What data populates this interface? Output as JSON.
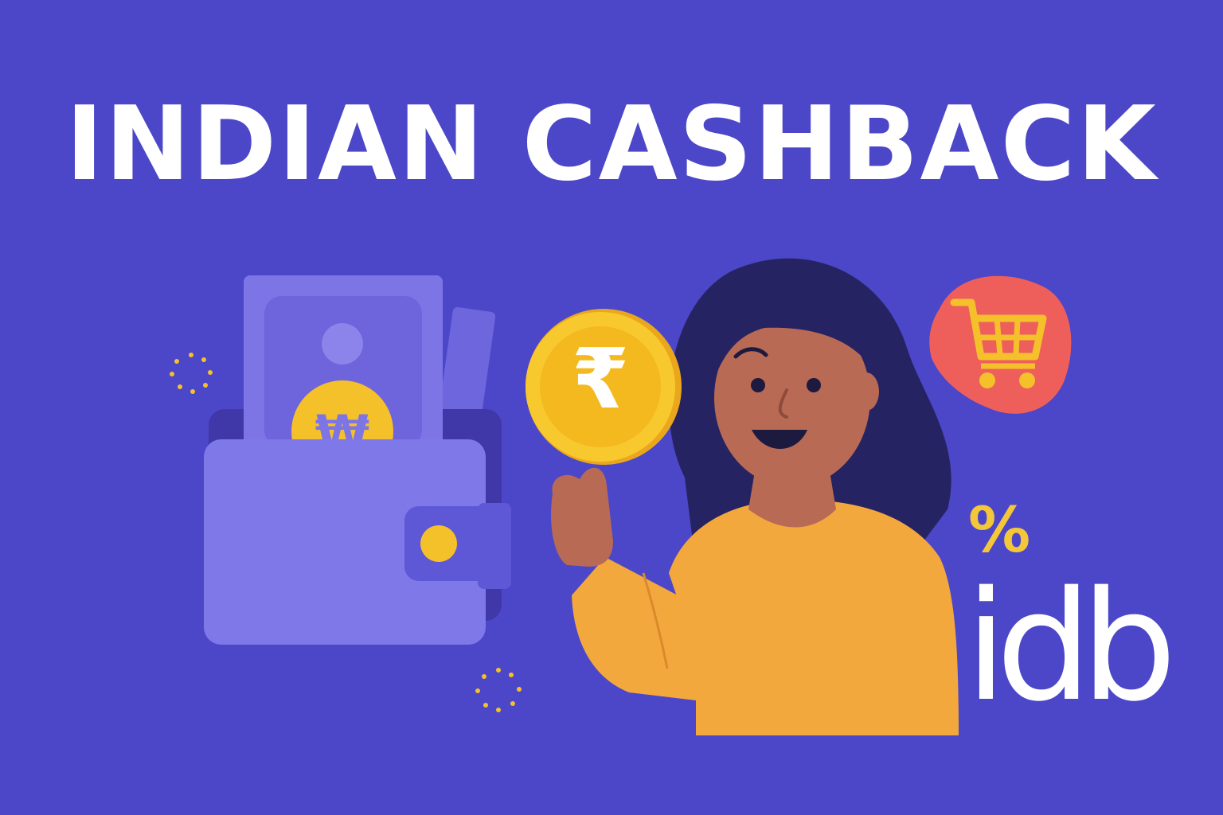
{
  "banner": {
    "title": "INDIAN CASHBACK",
    "logo_text": "idb",
    "percent_symbol": "%",
    "coin_symbol": "₹"
  },
  "colors": {
    "background": "#4b47c8",
    "wallet": "#7f78e8",
    "wallet_dark": "#5e57d6",
    "coin": "#f4c12b",
    "sweater": "#f3a83e",
    "skin": "#b86a55",
    "hair": "#262363",
    "cart_bubble": "#ee5f5b"
  },
  "icons": [
    "wallet-icon",
    "banknote-icon",
    "coin-icon",
    "rupee-coin-icon",
    "shopping-cart-icon",
    "percent-icon",
    "sparkle-icon"
  ]
}
